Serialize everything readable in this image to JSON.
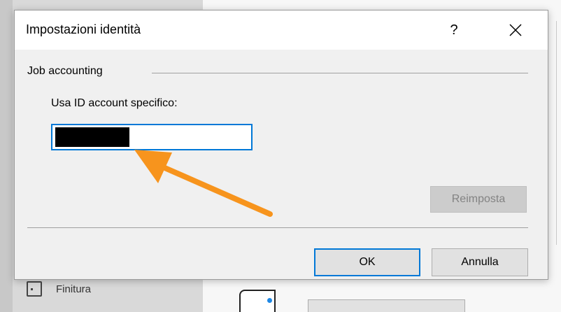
{
  "background_app": {
    "sidebar_item_label": "Finitura"
  },
  "dialog": {
    "title": "Impostazioni identità",
    "help_label": "?",
    "close_icon": "close-icon",
    "group_label": "Job accounting",
    "field_label": "Usa ID account specifico:",
    "account_id_value": "",
    "account_id_redacted": true,
    "reset_label": "Reimposta",
    "ok_label": "OK",
    "cancel_label": "Annulla"
  },
  "annotation": {
    "arrow_color": "#f7941d",
    "arrow_icon": "pointer-arrow-icon"
  },
  "colors": {
    "focus_accent": "#0078d7",
    "dialog_bg": "#f0f0f0",
    "button_bg": "#e1e1e1",
    "disabled_text": "#838383"
  }
}
